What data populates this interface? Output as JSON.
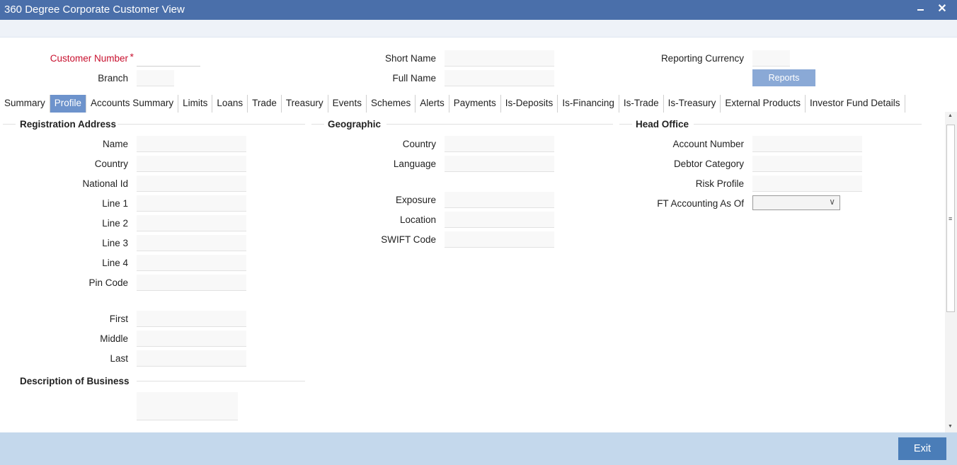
{
  "window": {
    "title": "360 Degree Corporate Customer View"
  },
  "header": {
    "customer_number_label": "Customer Number",
    "customer_number_value": "",
    "branch_label": "Branch",
    "branch_value": "",
    "short_name_label": "Short Name",
    "short_name_value": "",
    "full_name_label": "Full Name",
    "full_name_value": "",
    "reporting_currency_label": "Reporting Currency",
    "reporting_currency_value": "",
    "reports_button": "Reports"
  },
  "tabs": [
    "Summary",
    "Profile",
    "Accounts Summary",
    "Limits",
    "Loans",
    "Trade",
    "Treasury",
    "Events",
    "Schemes",
    "Alerts",
    "Payments",
    "Is-Deposits",
    "Is-Financing",
    "Is-Trade",
    "Is-Treasury",
    "External Products",
    "Investor Fund Details"
  ],
  "active_tab": "Profile",
  "registration": {
    "heading": "Registration Address",
    "name_label": "Name",
    "country_label": "Country",
    "national_id_label": "National Id",
    "line1_label": "Line 1",
    "line2_label": "Line 2",
    "line3_label": "Line 3",
    "line4_label": "Line 4",
    "pin_code_label": "Pin Code",
    "first_label": "First",
    "middle_label": "Middle",
    "last_label": "Last"
  },
  "description": {
    "heading": "Description of Business"
  },
  "geographic": {
    "heading": "Geographic",
    "country_label": "Country",
    "language_label": "Language",
    "exposure_label": "Exposure",
    "location_label": "Location",
    "swift_label": "SWIFT Code"
  },
  "head_office": {
    "heading": "Head Office",
    "account_number_label": "Account Number",
    "debtor_category_label": "Debtor Category",
    "risk_profile_label": "Risk Profile",
    "ft_accounting_label": "FT Accounting As Of",
    "ft_accounting_value": ""
  },
  "footer": {
    "exit_button": "Exit"
  },
  "colors": {
    "titlebar": "#4a6faa",
    "active_tab": "#6d93cc",
    "required": "#c8102e",
    "footer": "#c4d8ec",
    "exit": "#4a7db8"
  }
}
